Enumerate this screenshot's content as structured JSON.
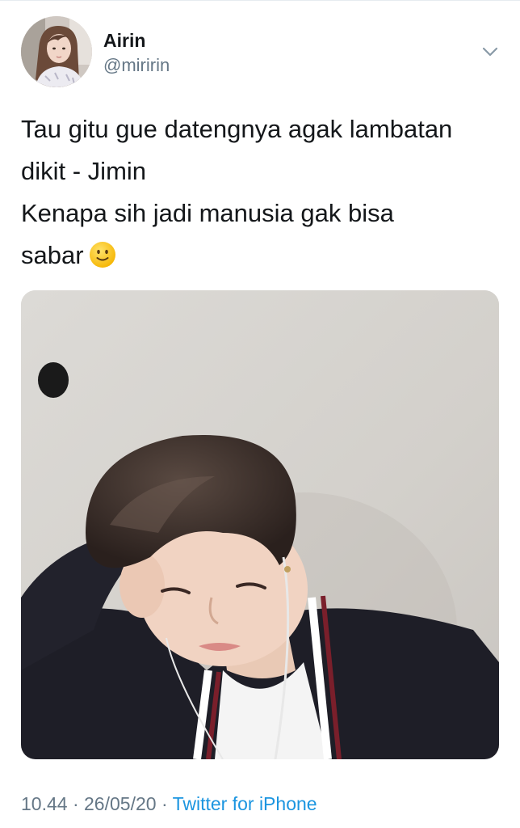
{
  "tweet": {
    "author": {
      "display_name": "Airin",
      "handle": "@miririn",
      "avatar_icon": "profile-photo"
    },
    "more_icon": "chevron-down-icon",
    "text_lines": [
      "Tau gitu gue datengnya agak lambatan",
      "dikit - Jimin",
      "Kenapa sih jadi manusia gak bisa",
      "sabar"
    ],
    "emoji": "slightly-smiling-face",
    "media": {
      "kind": "photo"
    },
    "meta": {
      "time": "10.44",
      "separator": "·",
      "date": "26/05/20",
      "source": "Twitter for iPhone"
    },
    "colors": {
      "text": "#14171a",
      "secondary": "#657786",
      "link": "#1b95e0"
    }
  }
}
